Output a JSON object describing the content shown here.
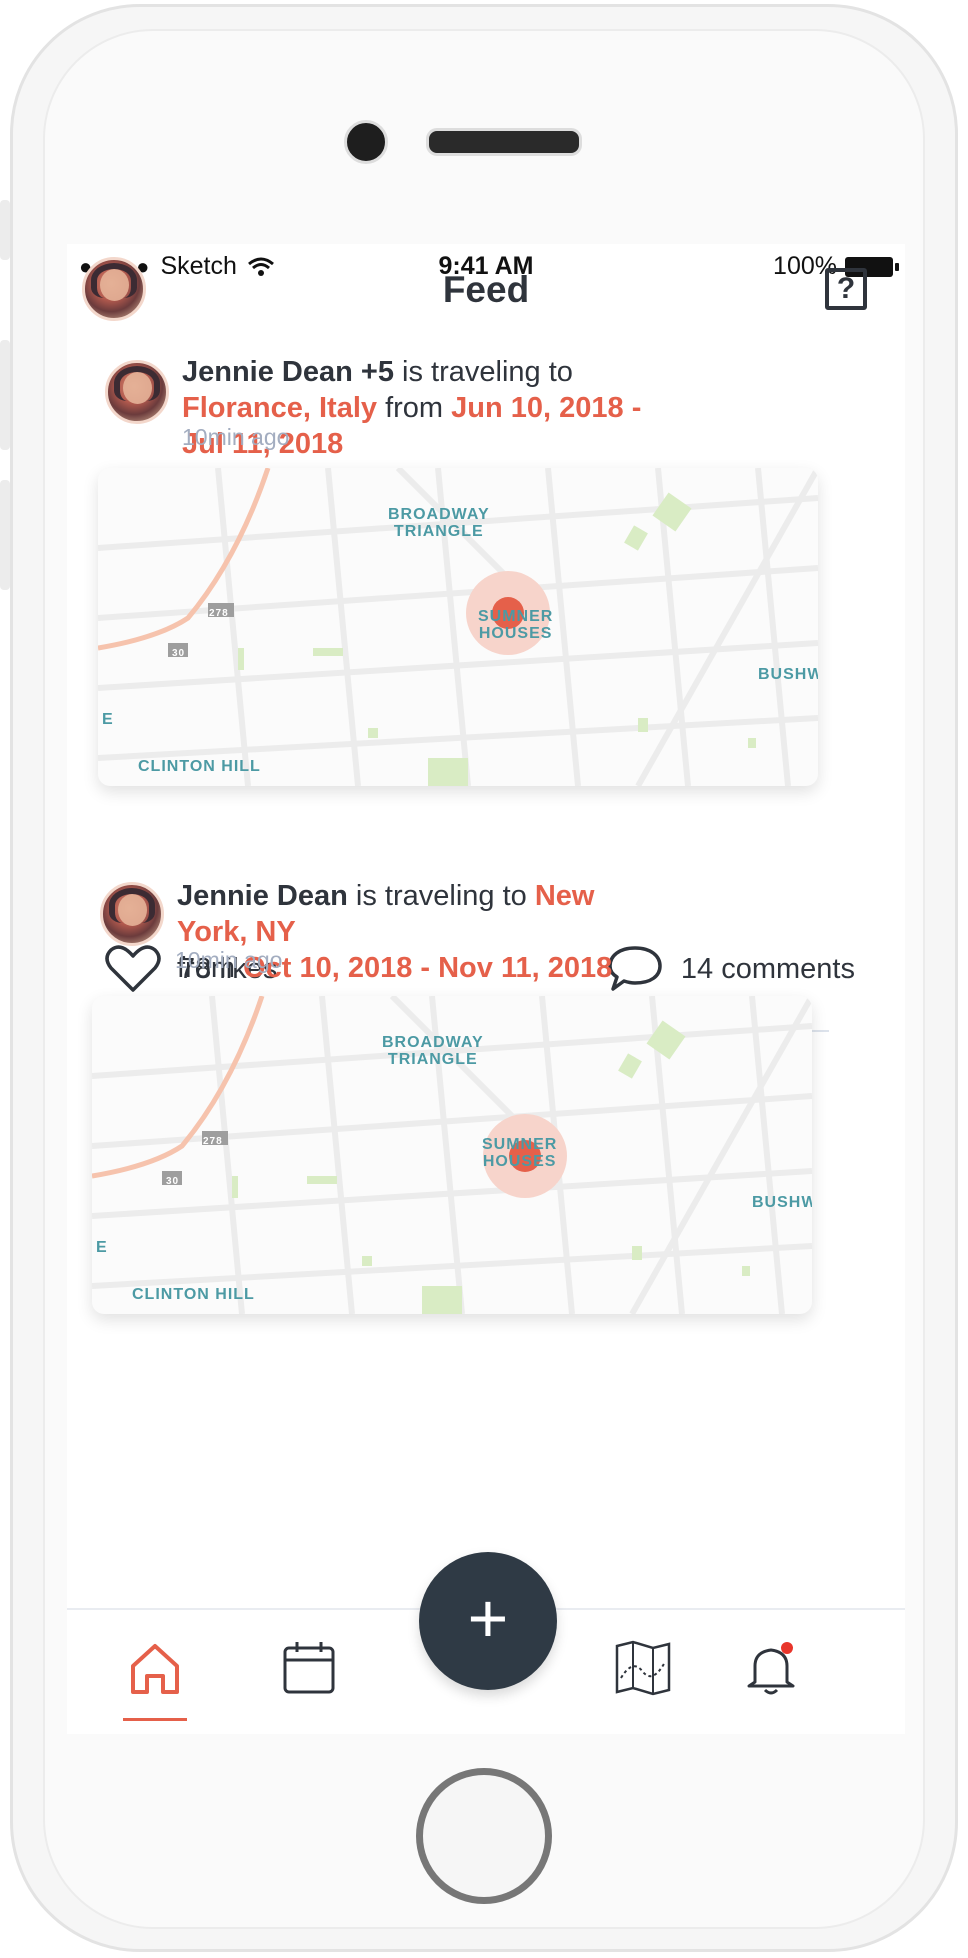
{
  "status_bar": {
    "signal": "●●●●●",
    "carrier": "Sketch",
    "time": "9:41 AM",
    "battery": "100%"
  },
  "header": {
    "title": "Feed",
    "help_label": "?"
  },
  "posts": [
    {
      "name": "Jennie Dean +5",
      "verb": " is traveling to ",
      "destination": "Florance, Italy",
      "from_word": " from ",
      "dates": "Jun 10, 2018 - Jul 11, 2018",
      "time_ago": "10min ago",
      "map_labels": [
        "BROADWAY TRIANGLE",
        "SUMNER HOUSES",
        "BUSHW",
        "CLINTON HILL",
        "E",
        "278",
        "30"
      ],
      "likes": "78 likes",
      "comments": "14 comments"
    },
    {
      "name": "Jennie Dean",
      "verb": " is traveling to ",
      "destination": "New York, NY",
      "from_word": "from ",
      "dates": "Oct 10, 2018 - Nov 11, 2018",
      "time_ago": "10min ago",
      "map_labels": [
        "BROADWAY TRIANGLE",
        "SUMNER HOUSES",
        "BUSHW",
        "CLINTON HILL",
        "E",
        "278",
        "30"
      ]
    }
  ],
  "fab": {
    "label": "+"
  },
  "tabbar": {
    "items": [
      {
        "icon": "home-icon",
        "active": true
      },
      {
        "icon": "calendar-icon",
        "active": false
      },
      {
        "icon": "map-icon",
        "active": false
      },
      {
        "icon": "bell-icon",
        "active": false,
        "badge": true
      }
    ]
  },
  "colors": {
    "accent": "#e5604a",
    "text": "#2f343c",
    "muted": "#a3adc0",
    "map_label": "#4c9aa4"
  }
}
